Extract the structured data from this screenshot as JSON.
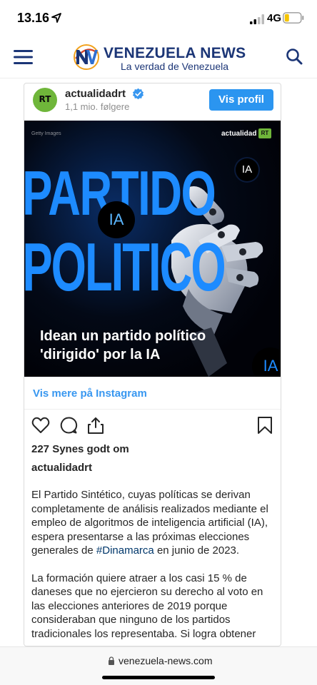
{
  "status_bar": {
    "time": "13.16",
    "network": "4G"
  },
  "site": {
    "title": "VENEZUELA NEWS",
    "subtitle": "La verdad de Venezuela"
  },
  "post": {
    "username": "actualidadrt",
    "avatar_text": "RT",
    "followers": "1,1 mio. følgere",
    "profile_button": "Vis profil",
    "image": {
      "watermark": "Getty Images",
      "brand": "actualidad",
      "brand_badge": "RT",
      "word1": "PARTIDO",
      "word2": "POLITICO",
      "ia_badge": "IA",
      "ia_circle": "IA",
      "ia_corner": "IA",
      "headline": "Idean un partido político 'dirigido' por la IA"
    },
    "more_link": "Vis mere på Instagram",
    "likes": "227 Synes godt om",
    "caption_user": "actualidadrt",
    "caption": {
      "p1_before": "El Partido Sintético, cuyas políticas se derivan completamente de análisis realizados mediante el empleo de algoritmos de inteligencia artificial (IA), espera presentarse a las próximas elecciones generales de ",
      "p1_hashtag": "#Dinamarca",
      "p1_after": " en junio de 2023.",
      "p2": "La formación quiere atraer a los casi 15 % de daneses que no ejercieron su derecho al voto en las elecciones anteriores de 2019 porque consideraban que ninguno de los partidos tradicionales los representaba. Si logra obtener"
    }
  },
  "url_bar": {
    "url": "venezuela-news.com"
  },
  "colors": {
    "brand_blue": "#1b3576",
    "ig_button": "#2b95f0",
    "ig_link": "#3897f0",
    "rt_green": "#6fb63a",
    "poster_blue": "#1d8bff"
  }
}
